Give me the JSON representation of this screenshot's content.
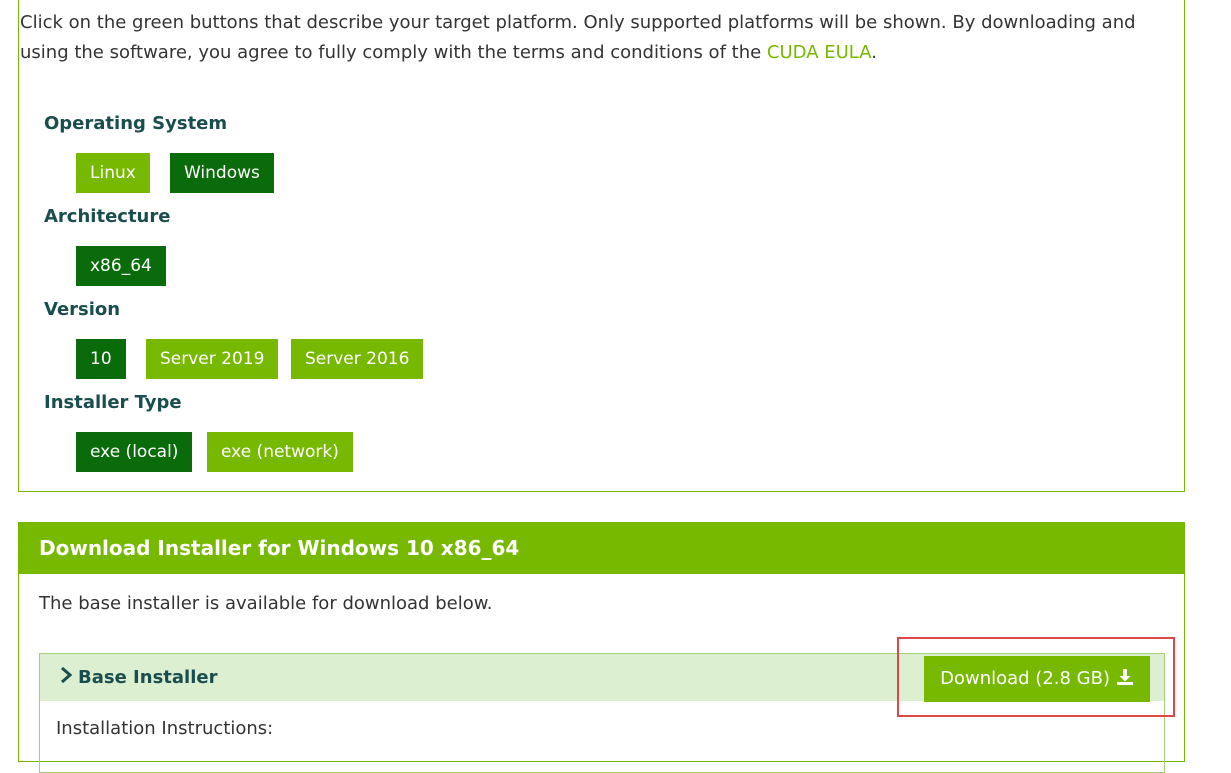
{
  "intro": {
    "text": "Click on the green buttons that describe your target platform. Only supported platforms will be shown. By downloading and using the software, you agree to fully comply with the terms and conditions of the ",
    "eula_link": "CUDA EULA",
    "end": "."
  },
  "os": {
    "label": "Operating System",
    "options": [
      "Linux",
      "Windows"
    ],
    "selected": "Windows"
  },
  "arch": {
    "label": "Architecture",
    "options": [
      "x86_64"
    ],
    "selected": "x86_64"
  },
  "version": {
    "label": "Version",
    "options": [
      "10",
      "Server 2019",
      "Server 2016"
    ],
    "selected": "10"
  },
  "installer_type": {
    "label": "Installer Type",
    "options": [
      "exe (local)",
      "exe (network)"
    ],
    "selected": "exe (local)"
  },
  "download": {
    "header": "Download Installer for Windows 10 x86_64",
    "description": "The base installer is available for download below.",
    "base_installer": {
      "title": "Base Installer",
      "button_label": "Download (2.8 GB)",
      "instructions_label": "Installation Instructions:"
    }
  },
  "colors": {
    "accent": "#76b900",
    "selected": "#0a6b0a",
    "highlight": "#e04848"
  }
}
